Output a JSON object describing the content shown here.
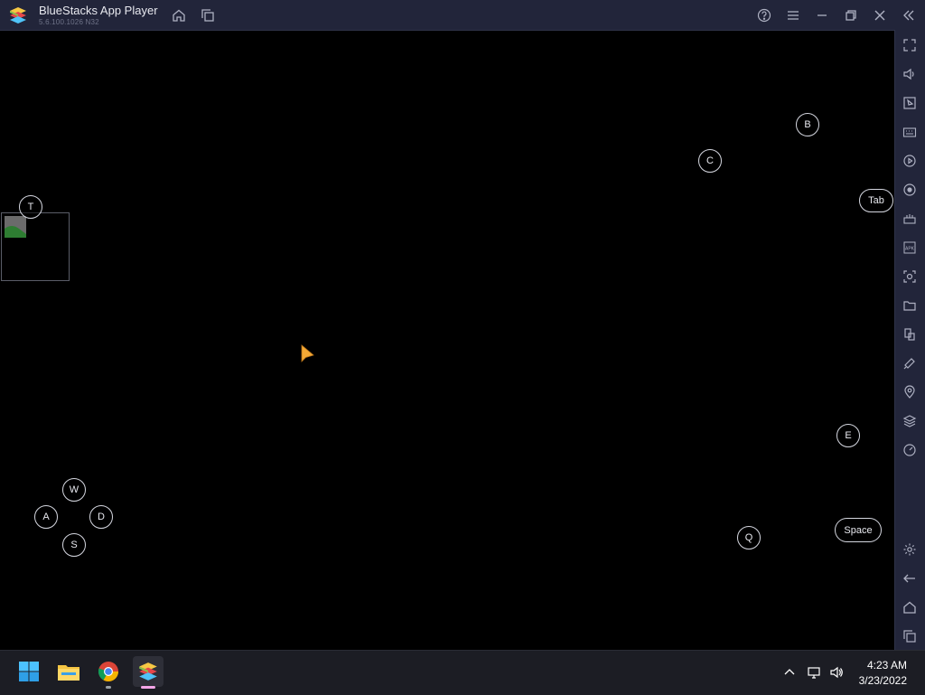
{
  "window": {
    "title": "BlueStacks App Player",
    "version": "5.6.100.1026  N32"
  },
  "game_controls": {
    "keys": {
      "T": "T",
      "B": "B",
      "C": "C",
      "Tab": "Tab",
      "E": "E",
      "Space": "Space",
      "Q": "Q",
      "W": "W",
      "A": "A",
      "S": "S",
      "D": "D"
    }
  },
  "taskbar": {
    "time": "4:23 AM",
    "date": "3/23/2022",
    "apps": [
      "start-icon",
      "file-explorer-icon",
      "chrome-icon",
      "bluestacks-icon"
    ]
  },
  "sidebar": {
    "icons": [
      "fullscreen-icon",
      "volume-icon",
      "media-folder-icon",
      "keyboard-icon",
      "macro-icon",
      "sync-icon",
      "controls-icon",
      "apk-icon",
      "screenshot-icon",
      "folder-icon",
      "multi-instance-icon",
      "rotate-icon",
      "location-icon",
      "layers-icon",
      "eco-mode-icon",
      "settings-icon",
      "back-icon",
      "home-icon",
      "recent-apps-icon"
    ]
  },
  "colors": {
    "titlebar_bg": "#22253a",
    "taskbar_bg": "#1c1d24",
    "game_bg": "#000000",
    "key_border": "#d5d7e0",
    "cursor": "#f4a935"
  }
}
